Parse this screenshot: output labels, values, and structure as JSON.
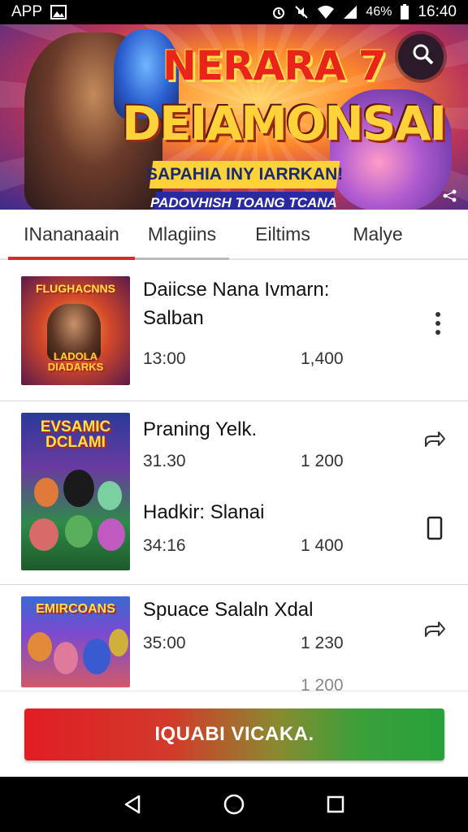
{
  "status_bar": {
    "app_label": "APP",
    "battery_text": "46%",
    "time": "16:40",
    "icons": [
      "image-icon",
      "alarm-icon",
      "mute-icon",
      "wifi-icon",
      "signal-icon",
      "battery-icon"
    ]
  },
  "banner": {
    "title_line1": "NERARA 7",
    "title_line2": "DEIAMONSAI",
    "subtitle": "SAPAHIA INY IARRKAN!",
    "tagline": "PADOVHISH TOANG TCANA",
    "icons": [
      "search-icon",
      "share-icon"
    ]
  },
  "tabs": [
    {
      "label": "INananaain",
      "active": true
    },
    {
      "label": "Mlagiins",
      "active": false
    },
    {
      "label": "Eiltims",
      "active": false
    },
    {
      "label": "Malye",
      "active": false
    }
  ],
  "list": {
    "items": [
      {
        "thumb_text": "FLUGHACNNS",
        "thumb_sub": "LADOLA DIADARKS",
        "title": "Daiicse Nana Ivmarn: Salban",
        "meta_left": "13:00",
        "meta_right": "1,400",
        "action_icon": "more-vert-icon"
      },
      {
        "thumb_text": "EVSAMIC DCLAMI",
        "title": "Praning Yelk.",
        "meta_left": "31.30",
        "meta_right": "1 200",
        "action_icon": "share-arrow-icon",
        "title2": "Hadkir: Slanai",
        "meta_left2": "34:16",
        "meta_right2": "1 400",
        "action_icon2": "phone-icon"
      },
      {
        "thumb_text": "EMIRCOANS",
        "title": "Spuace Salaln Xdal",
        "meta_left": "35:00",
        "meta_right": "1 230",
        "meta_peek": "1 200",
        "action_icon": "share-arrow-icon"
      }
    ]
  },
  "cta": {
    "label": "IQUABI VICAKA."
  },
  "nav_bar": {
    "icons": [
      "back-icon",
      "home-icon",
      "recents-icon"
    ]
  },
  "colors": {
    "accent_red": "#d62b2b",
    "cta_start": "#e01d24",
    "cta_end": "#27a13a"
  }
}
